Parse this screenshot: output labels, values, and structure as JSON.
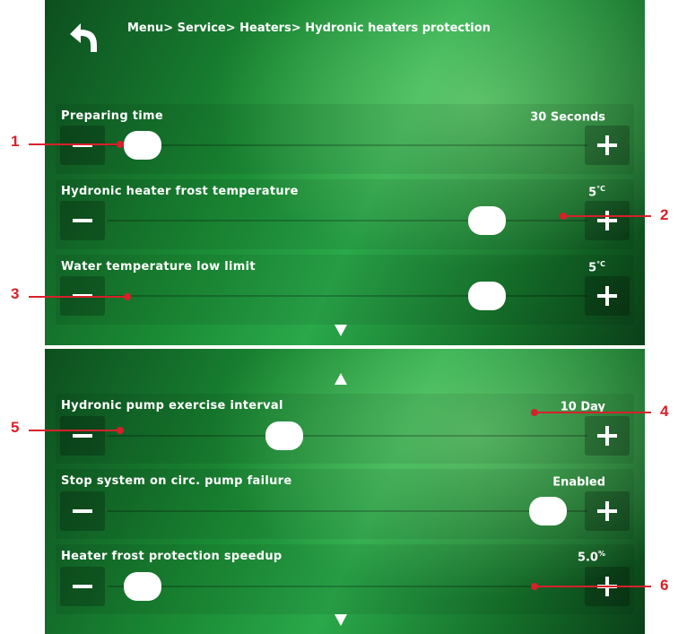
{
  "breadcrumb": "Menu> Service> Heaters> Hydronic heaters protection",
  "icons": {
    "back": "back-arrow-icon",
    "scroll_down": "scroll-down-arrow-icon",
    "scroll_up": "scroll-up-arrow-icon",
    "minus": "minus-icon",
    "plus": "plus-icon"
  },
  "colors": {
    "panel_green": "#1a8a34",
    "callout_red": "#d8202a",
    "knob": "#ffffff"
  },
  "settings": [
    {
      "label": "Preparing time",
      "value": "30 Seconds",
      "unit": "",
      "slider_level": 0.0
    },
    {
      "label": "Hydronic heater frost temperature",
      "value": "5",
      "unit": "°C",
      "slider_level": 0.85
    },
    {
      "label": "Water temperature low limit",
      "value": "5",
      "unit": "°C",
      "slider_level": 0.85
    },
    {
      "label": "Hydronic pump exercise interval",
      "value": "10 Day",
      "unit": "",
      "slider_level": 0.35
    },
    {
      "label": "Stop system on circ. pump failure",
      "value": "Enabled",
      "unit": "",
      "slider_level": 1.0
    },
    {
      "label": "Heater frost protection speedup",
      "value": "5.0",
      "unit": "%",
      "slider_level": 0.0
    }
  ],
  "callouts": [
    "1",
    "2",
    "3",
    "4",
    "5",
    "6"
  ]
}
